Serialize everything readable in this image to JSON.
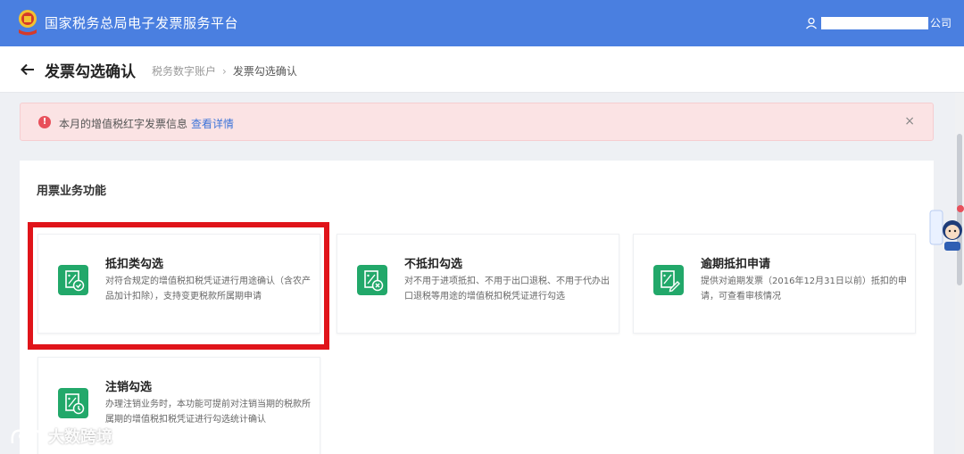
{
  "header": {
    "app_title": "国家税务总局电子发票服务平台",
    "user_suffix": "公司"
  },
  "subheader": {
    "page_title": "发票勾选确认",
    "breadcrumb": [
      "税务数字账户",
      "发票勾选确认"
    ]
  },
  "alert": {
    "message": "本月的增值税红字发票信息",
    "link": "查看详情",
    "close": "×"
  },
  "section": {
    "title": "用票业务功能"
  },
  "cards": [
    {
      "title": "抵扣类勾选",
      "desc": "对符合规定的增值税扣税凭证进行用途确认（含农产品加计扣除），支持变更税款所属期申请",
      "icon": "check-document-icon"
    },
    {
      "title": "不抵扣勾选",
      "desc": "对不用于进项抵扣、不用于出口退税、不用于代办出口退税等用途的增值税扣税凭证进行勾选",
      "icon": "cross-document-icon"
    },
    {
      "title": "逾期抵扣申请",
      "desc": "提供对逾期发票（2016年12月31日以前）抵扣的申请，可查看审核情况",
      "icon": "pen-document-icon"
    },
    {
      "title": "注销勾选",
      "desc": "办理注销业务时，本功能可提前对注销当期的税款所属期的增值税扣税凭证进行勾选统计确认",
      "icon": "clock-document-icon"
    }
  ],
  "watermark": {
    "text": "大数跨境"
  },
  "colors": {
    "brand_blue": "#4a7fe0",
    "card_icon_green": "#22a86a",
    "highlight_red": "#e0141a",
    "alert_bg": "#fbe3e4"
  }
}
